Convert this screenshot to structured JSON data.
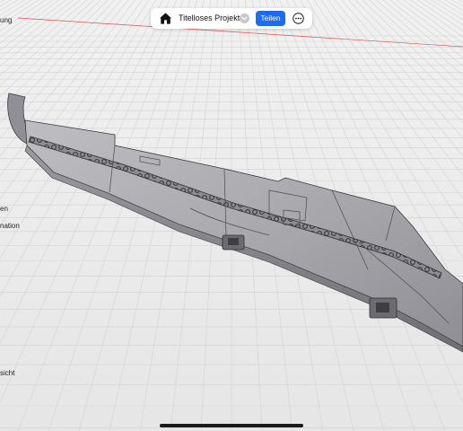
{
  "toolbar": {
    "project_title": "Titelloses Projekt",
    "share_label": "Teilen"
  },
  "side_panel": {
    "labels": [
      "ung",
      "en",
      "nation",
      "sicht"
    ]
  },
  "colors": {
    "accent": "#1d6af5",
    "background": "#eeeeee",
    "axis_line": "#e05050"
  },
  "icons": [
    "home-icon",
    "chevron-down-icon",
    "more-icon",
    "grabber-icon"
  ]
}
